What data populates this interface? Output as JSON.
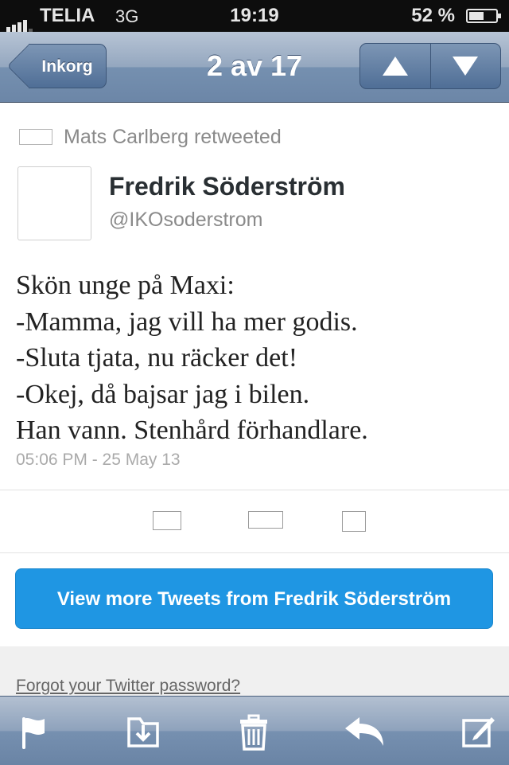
{
  "status_bar": {
    "carrier": "TELIA",
    "network": "3G",
    "time": "19:19",
    "battery_pct": "52 %"
  },
  "nav": {
    "back_label": "Inkorg",
    "title": "2 av 17",
    "prev_icon": "arrow-up-icon",
    "next_icon": "arrow-down-icon"
  },
  "tweet": {
    "retweeted_by": "Mats Carlberg retweeted",
    "author_name": "Fredrik Söderström",
    "author_handle": "@IKOsoderstrom",
    "lines": [
      "Skön unge på Maxi:",
      "-Mamma, jag vill ha mer godis.",
      "-Sluta tjata, nu räcker det!",
      "-Okej, då bajsar jag i bilen.",
      "Han vann. Stenhård förhandlare."
    ],
    "timestamp": "05:06 PM - 25 May 13"
  },
  "actions": {
    "icons": [
      "reply-icon",
      "retweet-icon",
      "favorite-icon"
    ]
  },
  "more_button": "View more Tweets from Fredrik Söderström",
  "footer_link": "Forgot your Twitter password?",
  "toolbar": {
    "icons": [
      "flag-icon",
      "move-to-folder-icon",
      "trash-icon",
      "reply-icon",
      "compose-icon"
    ]
  }
}
